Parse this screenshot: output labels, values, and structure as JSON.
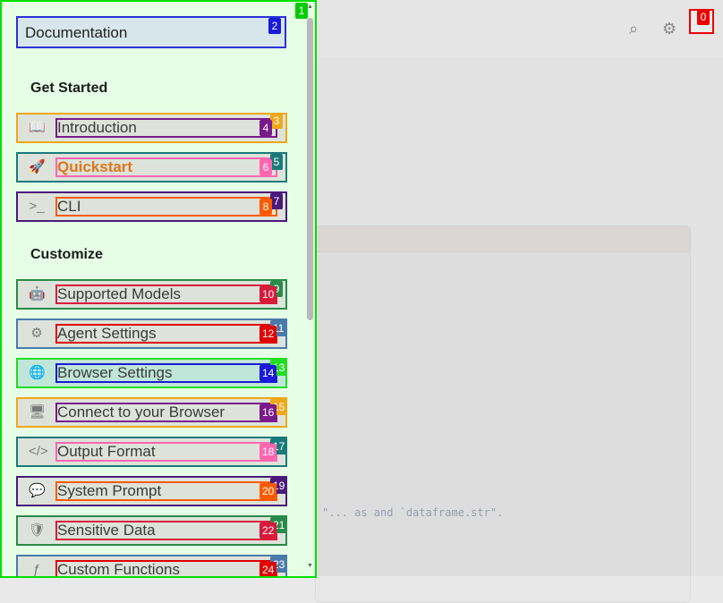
{
  "header": {
    "search_icon": "search-icon",
    "settings_icon": "gear-icon"
  },
  "background": {
    "code_snippet": "\"... as and `dataframe.str\"."
  },
  "sidebar": {
    "top_button": "Documentation",
    "sections": [
      {
        "heading": "Get Started",
        "items": [
          {
            "label": "Introduction",
            "icon": "book-icon",
            "active": false
          },
          {
            "label": "Quickstart",
            "icon": "rocket-icon",
            "active": true
          },
          {
            "label": "CLI",
            "icon": "terminal-icon",
            "active": false
          }
        ]
      },
      {
        "heading": "Customize",
        "items": [
          {
            "label": "Supported Models",
            "icon": "robot-icon",
            "active": false
          },
          {
            "label": "Agent Settings",
            "icon": "gear-icon",
            "active": false
          },
          {
            "label": "Browser Settings",
            "icon": "globe-icon",
            "active": false
          },
          {
            "label": "Connect to your Browser",
            "icon": "monitor-icon",
            "active": false
          },
          {
            "label": "Output Format",
            "icon": "code-icon",
            "active": false
          },
          {
            "label": "System Prompt",
            "icon": "chat-icon",
            "active": false
          },
          {
            "label": "Sensitive Data",
            "icon": "shield-icon",
            "active": false
          },
          {
            "label": "Custom Functions",
            "icon": "function-icon",
            "active": false
          }
        ]
      }
    ]
  },
  "badges": [
    "0",
    "1",
    "2",
    "3",
    "4",
    "5",
    "6",
    "7",
    "8",
    "9",
    "10",
    "11",
    "12",
    "13",
    "14",
    "15",
    "16",
    "17",
    "18",
    "19",
    "20",
    "21",
    "22",
    "23",
    "24"
  ],
  "colors": {
    "accent": "#e0761b",
    "drawer_border": "#00e000",
    "drawer_bg": "#e6fde6"
  }
}
